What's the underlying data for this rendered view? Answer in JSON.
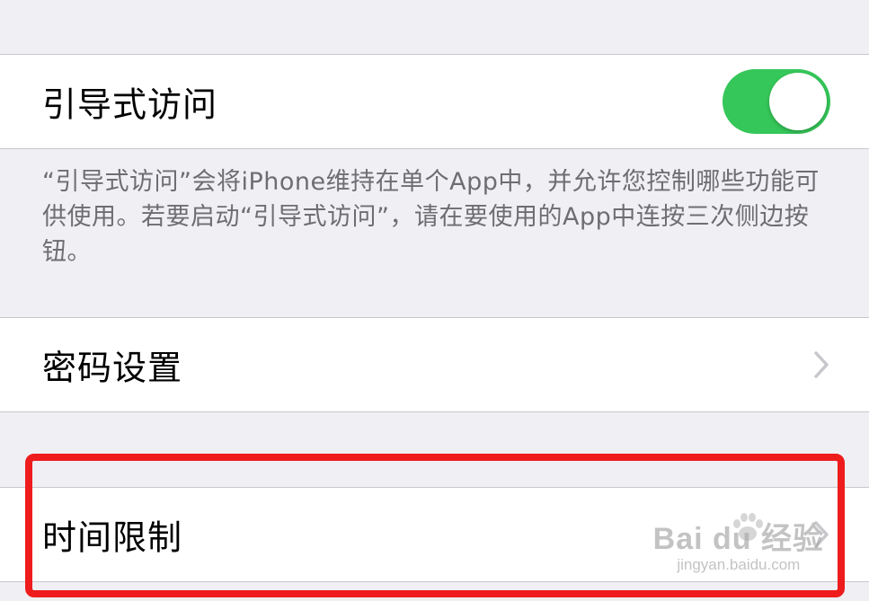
{
  "guided_access": {
    "label": "引导式访问",
    "toggle_state": "on",
    "toggle_color": "#35c759"
  },
  "footer": {
    "text": "“引导式访问”会将iPhone维持在单个App中，并允许您控制哪些功能可供使用。若要启动“引导式访问”，请在要使用的App中连按三次侧边按钮。"
  },
  "passcode_settings": {
    "label": "密码设置"
  },
  "time_limits": {
    "label": "时间限制"
  },
  "icons": {
    "chevron": "chevron-right-icon"
  },
  "watermark": {
    "brand": "Bai du 经验",
    "url": "jingyan.baidu.com"
  },
  "colors": {
    "background": "#efeff4",
    "highlight": "#ee1c1c",
    "footer_text": "#6d6d72"
  }
}
